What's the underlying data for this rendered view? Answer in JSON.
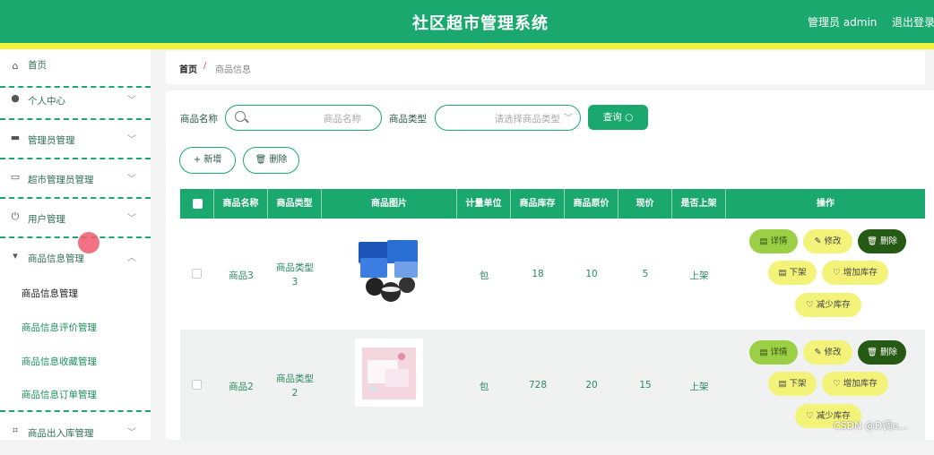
{
  "header": {
    "title": "社区超市管理系统",
    "user": "管理员 admin",
    "logout": "退出登录"
  },
  "sidebar": {
    "items": [
      {
        "label": "首页",
        "icon": "home-icon",
        "glyph": "⌂"
      },
      {
        "label": "个人中心",
        "icon": "user-icon",
        "glyph": "●"
      },
      {
        "label": "管理员管理",
        "icon": "monitor-icon",
        "glyph": "▬"
      },
      {
        "label": "超市管理员管理",
        "icon": "picture-icon",
        "glyph": "▭"
      },
      {
        "label": "用户管理",
        "icon": "power-icon",
        "glyph": "⏻"
      },
      {
        "label": "商品信息管理",
        "icon": "goods-icon",
        "glyph": "▾"
      }
    ],
    "subitems": [
      "商品信息管理",
      "商品信息评价管理",
      "商品信息收藏管理",
      "商品信息订单管理"
    ],
    "last_item": {
      "label": "商品出入库管理",
      "icon": "crop-icon",
      "glyph": "⌗"
    }
  },
  "breadcrumb": {
    "home": "首页",
    "separator": "/",
    "current": "商品信息"
  },
  "search": {
    "name_label": "商品名称",
    "name_placeholder": "商品名称",
    "type_label": "商品类型",
    "type_placeholder": "请选择商品类型",
    "query_label": "查询 ○"
  },
  "actions": {
    "add": "+ 新增",
    "delete": "🗑 删除"
  },
  "table": {
    "headers": [
      "商品名称",
      "商品类型",
      "商品图片",
      "计量单位",
      "商品库存",
      "商品原价",
      "现价",
      "是否上架",
      "操作"
    ],
    "rows": [
      {
        "name": "商品3",
        "type": "商品类型3",
        "unit": "包",
        "stock": "18",
        "original_price": "10",
        "price": "5",
        "on_sale": "上架"
      },
      {
        "name": "商品2",
        "type": "商品类型2",
        "unit": "包",
        "stock": "728",
        "original_price": "20",
        "price": "15",
        "on_sale": "上架"
      }
    ],
    "row_buttons": {
      "detail": "▤ 详情",
      "edit": "✎ 修改",
      "delete": "🗑 删除",
      "off_shelf": "▤ 下架",
      "add_stock": "♡ 增加库存",
      "reduce_stock": "♡ 减少库存"
    }
  },
  "watermark": "CSDN @D调e...",
  "colors": {
    "primary": "#1aa86e",
    "accent": "#f1f33a",
    "danger": "#265a14"
  }
}
